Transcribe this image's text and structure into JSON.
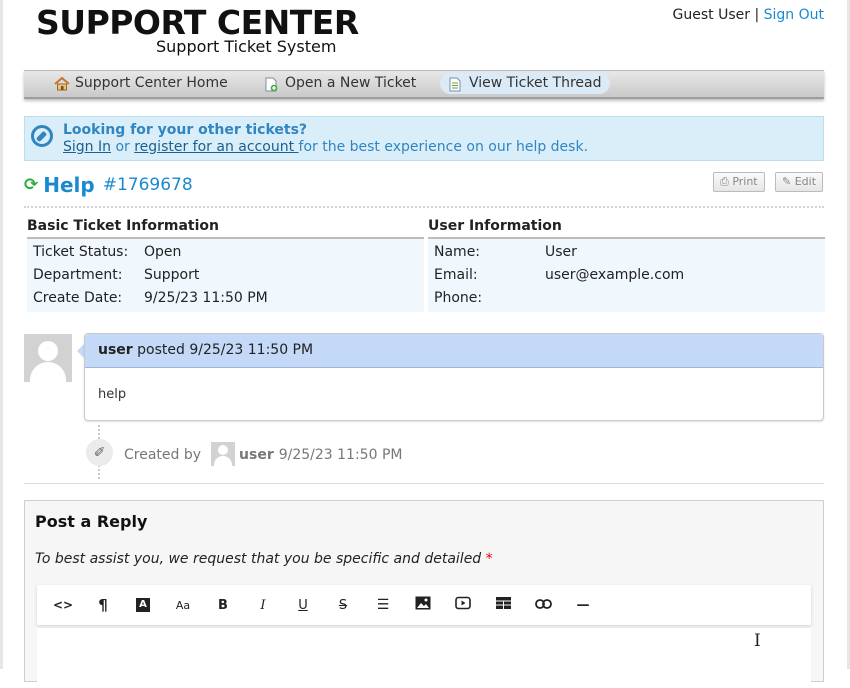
{
  "header": {
    "logo_main": "SUPPORT CENTER",
    "logo_sub": "Support Ticket System",
    "user_name": "Guest User",
    "separator": "|",
    "sign_out": "Sign Out"
  },
  "nav": {
    "items": [
      {
        "label": "Support Center Home",
        "icon": "home-icon"
      },
      {
        "label": "Open a New Ticket",
        "icon": "new-ticket-icon"
      },
      {
        "label": "View Ticket Thread",
        "icon": "ticket-thread-icon",
        "active": true
      }
    ]
  },
  "notice": {
    "title": "Looking for your other tickets?",
    "sign_in": "Sign In",
    "or": " or ",
    "register": "register for an account ",
    "rest": "for the best experience on our help desk."
  },
  "ticket": {
    "subject": "Help",
    "number": "#1769678",
    "print_label": "Print",
    "edit_label": "Edit"
  },
  "basic_info": {
    "heading": "Basic Ticket Information",
    "rows": [
      {
        "key": "Ticket Status:",
        "value": "Open"
      },
      {
        "key": "Department:",
        "value": "Support"
      },
      {
        "key": "Create Date:",
        "value": "9/25/23 11:50 PM"
      }
    ]
  },
  "user_info": {
    "heading": "User Information",
    "rows": [
      {
        "key": "Name:",
        "value": "User"
      },
      {
        "key": "Email:",
        "value": "user@example.com"
      },
      {
        "key": "Phone:",
        "value": ""
      }
    ]
  },
  "thread": {
    "entry": {
      "author": "user",
      "posted": "posted 9/25/23 11:50 PM",
      "body": "help"
    },
    "event": {
      "created_by": "Created by",
      "user": "user",
      "time": "9/25/23 11:50 PM"
    }
  },
  "reply": {
    "title": "Post a Reply",
    "hint": "To best assist you, we request that you be specific and detailed",
    "required_mark": "*",
    "toolbar": [
      {
        "name": "code-view-button",
        "glyph": "<>"
      },
      {
        "name": "paragraph-button",
        "glyph": "¶"
      },
      {
        "name": "font-color-button",
        "glyph": "A"
      },
      {
        "name": "font-size-button",
        "glyph": "Aa"
      },
      {
        "name": "bold-button",
        "glyph": "B"
      },
      {
        "name": "italic-button",
        "glyph": "I"
      },
      {
        "name": "underline-button",
        "glyph": "U"
      },
      {
        "name": "strikethrough-button",
        "glyph": "S"
      },
      {
        "name": "list-button",
        "glyph": "☰"
      },
      {
        "name": "image-button",
        "glyph": "▣"
      },
      {
        "name": "video-button",
        "glyph": "▶"
      },
      {
        "name": "table-button",
        "glyph": "▦"
      },
      {
        "name": "link-button",
        "glyph": "⊂⊃"
      },
      {
        "name": "horizontal-rule-button",
        "glyph": "—"
      }
    ]
  }
}
